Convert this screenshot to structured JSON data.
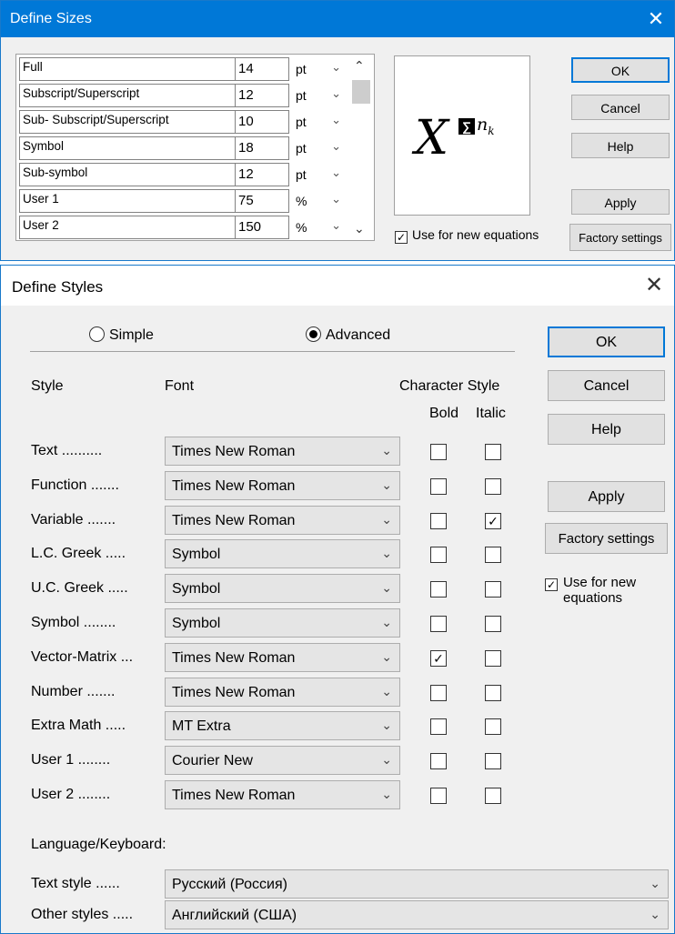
{
  "sizes": {
    "title": "Define Sizes",
    "rows": [
      {
        "name": "Full",
        "value": "14",
        "unit": "pt"
      },
      {
        "name": "Subscript/Superscript",
        "value": "12",
        "unit": "pt"
      },
      {
        "name": "Sub- Subscript/Superscript",
        "value": "10",
        "unit": "pt"
      },
      {
        "name": "Symbol",
        "value": "18",
        "unit": "pt"
      },
      {
        "name": "Sub-symbol",
        "value": "12",
        "unit": "pt"
      },
      {
        "name": "User 1",
        "value": "75",
        "unit": "%"
      },
      {
        "name": "User 2",
        "value": "150",
        "unit": "%"
      }
    ],
    "preview": {
      "base": "X",
      "symbol": "∑",
      "sup": "n",
      "sub": "k"
    },
    "use_for_new": "Use for new equations",
    "use_for_new_checked": true,
    "buttons": {
      "ok": "OK",
      "cancel": "Cancel",
      "help": "Help",
      "apply": "Apply",
      "factory": "Factory settings"
    }
  },
  "styles": {
    "title": "Define Styles",
    "mode_simple": "Simple",
    "mode_advanced": "Advanced",
    "selected_mode": "Advanced",
    "headers": {
      "style": "Style",
      "font": "Font",
      "char_style": "Character Style",
      "bold": "Bold",
      "italic": "Italic"
    },
    "rows": [
      {
        "label": "Text ..........",
        "font": "Times New Roman",
        "bold": false,
        "italic": false
      },
      {
        "label": "Function .......",
        "font": "Times New Roman",
        "bold": false,
        "italic": false
      },
      {
        "label": "Variable .......",
        "font": "Times New Roman",
        "bold": false,
        "italic": true
      },
      {
        "label": "L.C. Greek .....",
        "font": "Symbol",
        "bold": false,
        "italic": false
      },
      {
        "label": "U.C. Greek .....",
        "font": "Symbol",
        "bold": false,
        "italic": false
      },
      {
        "label": "Symbol ........",
        "font": "Symbol",
        "bold": false,
        "italic": false
      },
      {
        "label": "Vector-Matrix ...",
        "font": "Times New Roman",
        "bold": true,
        "italic": false
      },
      {
        "label": "Number .......",
        "font": "Times New Roman",
        "bold": false,
        "italic": false
      },
      {
        "label": "Extra Math .....",
        "font": "MT Extra",
        "bold": false,
        "italic": false
      },
      {
        "label": "User 1 ........",
        "font": "Courier New",
        "bold": false,
        "italic": false
      },
      {
        "label": "User 2 ........",
        "font": "Times New Roman",
        "bold": false,
        "italic": false
      }
    ],
    "language_label": "Language/Keyboard:",
    "text_style_label": "Text style ......",
    "text_style_value": "Русский (Россия)",
    "other_styles_label": "Other styles .....",
    "other_styles_value": "Английский (США)",
    "use_for_new": "Use for new equations",
    "use_for_new_checked": true,
    "buttons": {
      "ok": "OK",
      "cancel": "Cancel",
      "help": "Help",
      "apply": "Apply",
      "factory": "Factory settings"
    }
  }
}
